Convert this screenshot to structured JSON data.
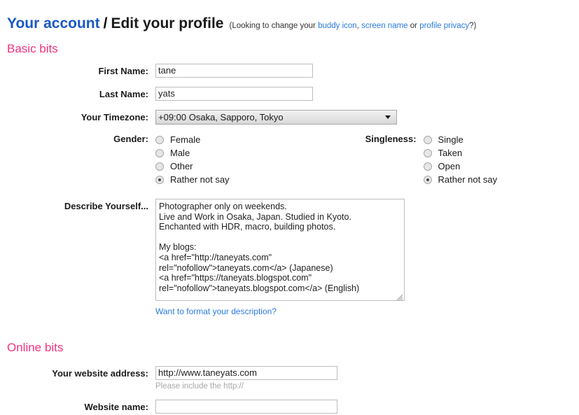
{
  "header": {
    "account_link": "Your account",
    "separator": "/",
    "page_title": "Edit your profile",
    "note_prefix": "(Looking to change your ",
    "note_link_1": "buddy icon",
    "note_comma": ", ",
    "note_link_2": "screen name",
    "note_or": " or ",
    "note_link_3": "profile privacy",
    "note_suffix": "?)"
  },
  "sections": {
    "basic_heading": "Basic bits",
    "online_heading": "Online bits"
  },
  "fields": {
    "first_name": {
      "label": "First Name:",
      "value": "tane",
      "placeholder": ""
    },
    "last_name": {
      "label": "Last Name:",
      "value": "yats",
      "placeholder": ""
    },
    "timezone": {
      "label": "Your Timezone:",
      "selected": "+09:00 Osaka, Sapporo, Tokyo",
      "options": [
        "+09:00 Osaka, Sapporo, Tokyo"
      ]
    },
    "gender": {
      "label": "Gender:",
      "options": [
        {
          "label": "Female",
          "checked": false
        },
        {
          "label": "Male",
          "checked": false
        },
        {
          "label": "Other",
          "checked": false
        },
        {
          "label": "Rather not say",
          "checked": true
        }
      ]
    },
    "singleness": {
      "label": "Singleness:",
      "options": [
        {
          "label": "Single",
          "checked": false
        },
        {
          "label": "Taken",
          "checked": false
        },
        {
          "label": "Open",
          "checked": false
        },
        {
          "label": "Rather not say",
          "checked": true
        }
      ]
    },
    "describe": {
      "label": "Describe Yourself...",
      "value": "Photographer only on weekends.\nLive and Work in Osaka, Japan. Studied in Kyoto.\nEnchanted with HDR, macro, building photos.\n\nMy blogs:\n<a href=\"http://taneyats.com\" rel=\"nofollow\">taneyats.com</a> (Japanese)\n<a href=\"https://taneyats.blogspot.com\" rel=\"nofollow\">taneyats.blogspot.com</a> (English)",
      "format_link": "Want to format your description?"
    },
    "website_address": {
      "label": "Your website address:",
      "value": "http://www.taneyats.com",
      "hint": "Please include the http://"
    },
    "website_name": {
      "label": "Website name:",
      "value": "",
      "placeholder": ""
    }
  },
  "colors": {
    "section_pink": "#f5317f",
    "link_blue": "#2a7ae2",
    "title_blue": "#1a58c4",
    "hint_gray": "#a8a8a8"
  },
  "icons": {
    "dropdown": "chevron-down-icon",
    "resize": "resize-grip-icon"
  }
}
